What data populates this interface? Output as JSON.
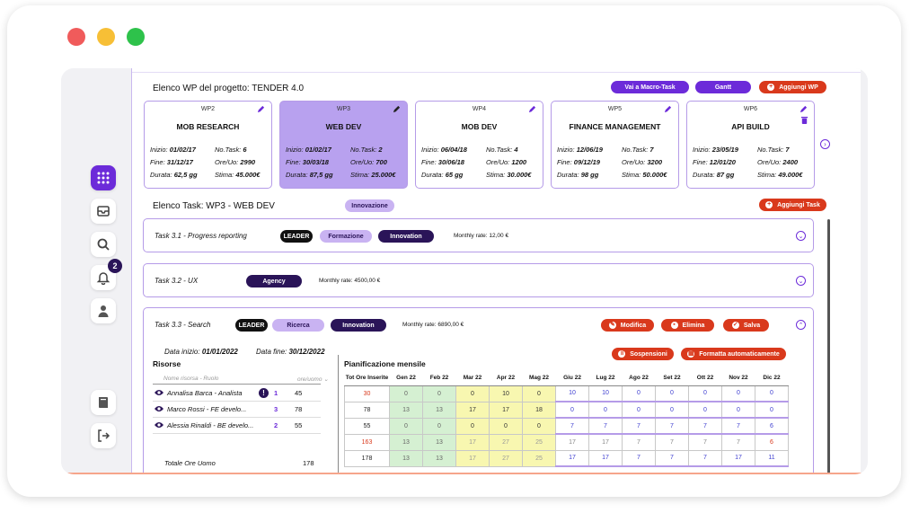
{
  "window_controls": [
    "close",
    "minimize",
    "maximize"
  ],
  "sidebar": {
    "items": [
      {
        "icon": "grid-icon",
        "active": true
      },
      {
        "icon": "inbox-icon",
        "active": false
      },
      {
        "icon": "search-icon",
        "active": false
      },
      {
        "icon": "bell-icon",
        "active": false,
        "badge": "2"
      },
      {
        "icon": "user-icon",
        "active": false
      },
      {
        "icon": "book-icon",
        "active": false
      },
      {
        "icon": "logout-icon",
        "active": false
      }
    ]
  },
  "wp_section": {
    "title": "Elenco WP del progetto: TENDER 4.0",
    "buttons": {
      "macro": "Vai a Macro-Task",
      "gantt": "Gantt",
      "add": "Aggiungi WP"
    },
    "cards": [
      {
        "code": "WP2",
        "name": "MOB RESEARCH",
        "selected": false,
        "l_start": "Inizio:",
        "start": "01/02/17",
        "l_end": "Fine:",
        "end": "31/12/17",
        "l_dur": "Durata:",
        "dur": "62,5 gg",
        "l_nt": "No.Task:",
        "nt": "6",
        "l_ore": "Ore/Uo:",
        "ore": "2990",
        "l_stima": "Stima:",
        "stima": "45.000€"
      },
      {
        "code": "WP3",
        "name": "WEB DEV",
        "selected": true,
        "l_start": "Inizio:",
        "start": "01/02/17",
        "l_end": "Fine:",
        "end": "30/03/18",
        "l_dur": "Durata:",
        "dur": "87,5 gg",
        "l_nt": "No.Task:",
        "nt": "2",
        "l_ore": "Ore/Uo:",
        "ore": "700",
        "l_stima": "Stima:",
        "stima": "25.000€"
      },
      {
        "code": "WP4",
        "name": "MOB DEV",
        "selected": false,
        "l_start": "Inizio:",
        "start": "06/04/18",
        "l_end": "Fine:",
        "end": "30/06/18",
        "l_dur": "Durata:",
        "dur": "65 gg",
        "l_nt": "No.Task:",
        "nt": "4",
        "l_ore": "Ore/Uo:",
        "ore": "1200",
        "l_stima": "Stima:",
        "stima": "30.000€"
      },
      {
        "code": "WP5",
        "name": "FINANCE MANAGEMENT",
        "selected": false,
        "l_start": "Inizio:",
        "start": "12/06/19",
        "l_end": "Fine:",
        "end": "09/12/19",
        "l_dur": "Durata:",
        "dur": "98 gg",
        "l_nt": "No.Task:",
        "nt": "7",
        "l_ore": "Ore/Uo:",
        "ore": "3200",
        "l_stima": "Stima:",
        "stima": "50.000€"
      },
      {
        "code": "WP6",
        "name": "API BUILD",
        "selected": false,
        "l_start": "Inizio:",
        "start": "23/05/19",
        "l_end": "Fine:",
        "end": "12/01/20",
        "l_dur": "Durata:",
        "dur": "87 gg",
        "l_nt": "No.Task:",
        "nt": "7",
        "l_ore": "Ore/Uo:",
        "ore": "2400",
        "l_stima": "Stima:",
        "stima": "49.000€"
      }
    ]
  },
  "task_section": {
    "title": "Elenco Task: WP3 - WEB DEV",
    "tag": "Innovazione",
    "add_button": "Aggiungi Task",
    "tasks": [
      {
        "name": "Task 3.1 -  Progress reporting",
        "leader": "LEADER",
        "tag1": "Formazione",
        "tag2": "Innovation",
        "rate": "Monthly rate: 12,00 €"
      },
      {
        "name": "Task 3.2 -  UX",
        "tag2": "Agency",
        "rate": "Monthly rate: 4500,00 €"
      },
      {
        "name": "Task 3.3 -  Search",
        "leader": "LEADER",
        "tag1": "Ricerca",
        "tag2": "Innovation",
        "rate": "Monthly rate: 6890,00 €"
      }
    ],
    "actions": {
      "modifica": "Modifica",
      "elimina": "Elimina",
      "salva": "Salva",
      "sospensioni": "Sospensioni",
      "formatta": "Formatta automaticamente"
    }
  },
  "detail": {
    "start_label": "Data inizio:",
    "start": "01/01/2022",
    "end_label": "Data fine:",
    "end": "30/12/2022",
    "resources_title": "Risorse",
    "col_name": "Nome risorsa - Ruolo",
    "col_hours": "ore/uomo ⌄",
    "resources": [
      {
        "name": "Annalisa Barca - Analista",
        "alert": "!",
        "idx": "1",
        "hours": "45"
      },
      {
        "name": "Marco Rossi - FE develo...",
        "idx": "3",
        "hours": "78"
      },
      {
        "name": "Alessia Rinaldi - BE develo...",
        "idx": "2",
        "hours": "55"
      }
    ],
    "totals_label": "Totale Ore Uomo",
    "totals_value": "178",
    "plan_title": "Pianificazione mensile",
    "tot_header": "Tot Ore Inserite",
    "months": [
      "Gen 22",
      "Feb 22",
      "Mar 22",
      "Apr 22",
      "Mag 22",
      "Giu 22",
      "Lug 22",
      "Ago 22",
      "Set 22",
      "Ott 22",
      "Nov 22",
      "Dic 22"
    ],
    "rows": [
      {
        "tot": "30",
        "cells": [
          "0",
          "0",
          "0",
          "10",
          "0",
          "10",
          "10",
          "0",
          "0",
          "0",
          "0",
          "0"
        ]
      },
      {
        "tot": "78",
        "cells": [
          "13",
          "13",
          "17",
          "17",
          "18",
          "0",
          "0",
          "0",
          "0",
          "0",
          "0",
          "0"
        ]
      },
      {
        "tot": "55",
        "cells": [
          "0",
          "0",
          "0",
          "0",
          "0",
          "7",
          "7",
          "7",
          "7",
          "7",
          "7",
          "6"
        ]
      },
      {
        "tot": "163",
        "cells": [
          "13",
          "13",
          "17",
          "27",
          "25",
          "17",
          "17",
          "7",
          "7",
          "7",
          "7",
          "6"
        ]
      },
      {
        "tot": "178",
        "cells": [
          "13",
          "13",
          "17",
          "27",
          "25",
          "17",
          "17",
          "7",
          "7",
          "7",
          "17",
          "11"
        ]
      }
    ]
  },
  "colors": {
    "accent": "#6c2bd9",
    "danger": "#d9391c",
    "lavender": "#c9b3f2",
    "navy": "#2a1458",
    "green": "#d5f0d2",
    "yellow": "#f8f7b0"
  }
}
